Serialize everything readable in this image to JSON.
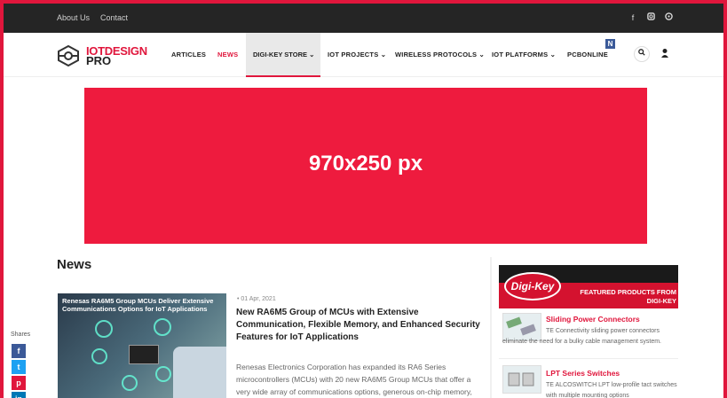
{
  "topbar": {
    "links": [
      "About Us",
      "Contact"
    ],
    "social_icons": [
      "facebook-icon",
      "instagram-icon",
      "pinterest-icon"
    ]
  },
  "logo": {
    "line1": "IOTDESIGN",
    "line2": "PRO"
  },
  "nav": {
    "items": [
      {
        "label": "ARTICLES"
      },
      {
        "label": "NEWS"
      },
      {
        "label": "DIGI-KEY STORE ⌄"
      },
      {
        "label": "IOT PROJECTS ⌄"
      },
      {
        "label": "WIRELESS PROTOCOLS ⌄"
      },
      {
        "label": "IOT PLATFORMS ⌄"
      },
      {
        "label": "PCBONLINE"
      }
    ],
    "badge": "N",
    "search_icon": "search-icon",
    "user_icon": "user-icon"
  },
  "banner": {
    "text": "970x250 px"
  },
  "news": {
    "section_title": "News",
    "article": {
      "image_caption": "Renesas RA6M5 Group MCUs Deliver Extensive Communications Options for IoT Applications",
      "date": "• 01 Apr, 2021",
      "title": "New RA6M5 Group of MCUs with Extensive Communication, Flexible Memory, and Enhanced Security Features for IoT Applications",
      "excerpt": "Renesas Electronics Corporation has expanded its RA6 Series microcontrollers (MCUs) with 20 new RA6M5 Group MCUs that offer a very wide array of communications options, generous on-chip memory, and Renesas' best"
    }
  },
  "share": {
    "label": "Shares",
    "buttons": [
      {
        "icon": "facebook-icon",
        "glyph": "f",
        "color": "#3b5998"
      },
      {
        "icon": "twitter-icon",
        "glyph": "t",
        "color": "#1da1f2"
      },
      {
        "icon": "pinterest-icon",
        "glyph": "p",
        "color": "#e0163c"
      },
      {
        "icon": "linkedin-icon",
        "glyph": "in",
        "color": "#0077b5"
      }
    ]
  },
  "sidebar": {
    "digikey_logo": "Digi-Key",
    "featured": "FEATURED PRODUCTS FROM DIGI-KEY",
    "products": [
      {
        "title": "Sliding Power Connectors",
        "desc": "TE Connectivity sliding power connectors eliminate the need for a bulky cable management system."
      },
      {
        "title": "LPT Series Switches",
        "desc": "TE ALCOSWITCH LPT low-profile tact switches with multiple mounting options"
      }
    ]
  },
  "colors": {
    "accent": "#e0163c",
    "banner": "#ee1b3e",
    "topbar": "#252525"
  }
}
